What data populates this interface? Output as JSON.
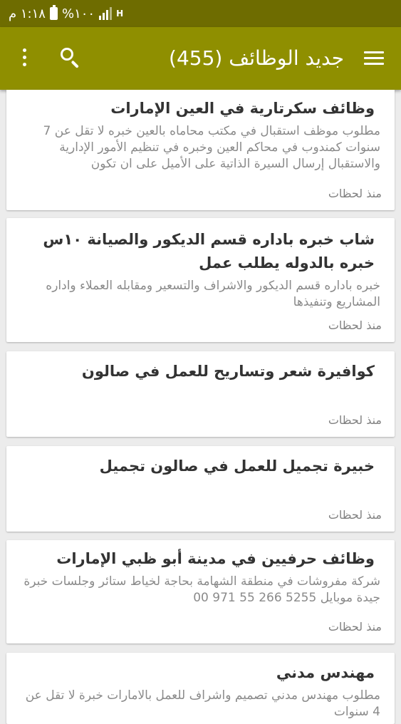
{
  "status_bar": {
    "time": "١:١٨ م",
    "battery": "%١٠٠",
    "network": "H"
  },
  "app_bar": {
    "title": "جديد الوظائف (455)",
    "icons": [
      "menu-icon",
      "search-icon",
      "more-vertical-icon"
    ]
  },
  "jobs": [
    {
      "title": "وظائف سكرتارية في العين الإمارات",
      "description": "مطلوب موظف استقبال في مكتب محاماه بالعين خبره لا تقل عن 7 سنوات كمندوب في محاكم العين وخبره في تنظيم الأمور الإدارية والاستقبال إرسال السيرة الذاتية على الأميل على ان تكون",
      "time": "منذ لحظات"
    },
    {
      "title": "شاب خبره باداره قسم الديكور والصيانة ١٠س خبره بالدوله يطلب عمل",
      "description": "خبره باداره قسم الديكور والاشراف والتسعير ومقابله العملاء واداره المشاريع وتنفيذها",
      "time": "منذ لحظات"
    },
    {
      "title": "كوافيرة شعر وتساريح للعمل في صالون",
      "description": "",
      "time": "منذ لحظات"
    },
    {
      "title": "خبيرة تجميل للعمل في صالون تجميل",
      "description": "",
      "time": "منذ لحظات"
    },
    {
      "title": "وظائف حرفيين في مدينة أبو ظبي الإمارات",
      "description": "شركة مفروشات في منطقة الشهامة بحاجة لخياط ستائر وجلسات خبرة جيدة موبايل 5255 266 55 971 00",
      "time": "منذ لحظات"
    },
    {
      "title": "مهندس مدني",
      "description": "مطلوب مهندس مدني تصميم واشراف للعمل بالامارات خبرة لا تقل عن 4 سنوات",
      "time": ""
    }
  ]
}
